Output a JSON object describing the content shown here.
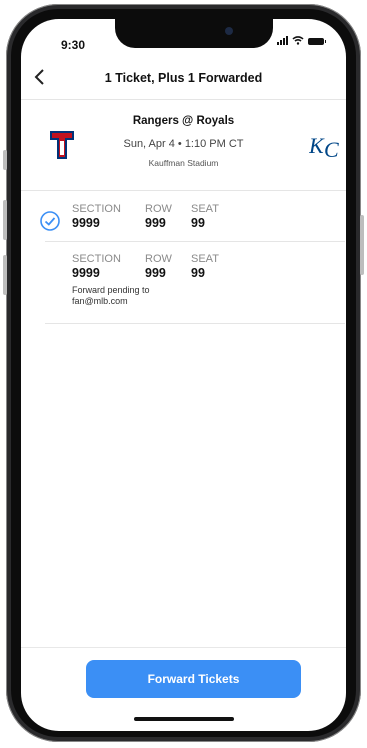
{
  "status_bar": {
    "time": "9:30"
  },
  "nav": {
    "title": "1 Ticket, Plus 1 Forwarded"
  },
  "game": {
    "home_logo_text": "T",
    "away_logo_text": "KC",
    "matchup": "Rangers @ Royals",
    "datetime": "Sun, Apr 4 • 1:10 PM CT",
    "venue": "Kauffman Stadium"
  },
  "tickets": [
    {
      "section_label": "SECTION",
      "section": "9999",
      "row_label": "ROW",
      "row": "999",
      "seat_label": "SEAT",
      "seat": "99",
      "selected": true
    },
    {
      "section_label": "SECTION",
      "section": "9999",
      "row_label": "ROW",
      "row": "999",
      "seat_label": "SEAT",
      "seat": "99",
      "status_line1": "Forward pending to",
      "status_line2": "fan@mlb.com"
    }
  ],
  "cta": {
    "label": "Forward Tickets"
  },
  "colors": {
    "accent": "#3b8ff5",
    "rangers_red": "#c0111f",
    "rangers_blue": "#003278",
    "royals_blue": "#004687"
  }
}
